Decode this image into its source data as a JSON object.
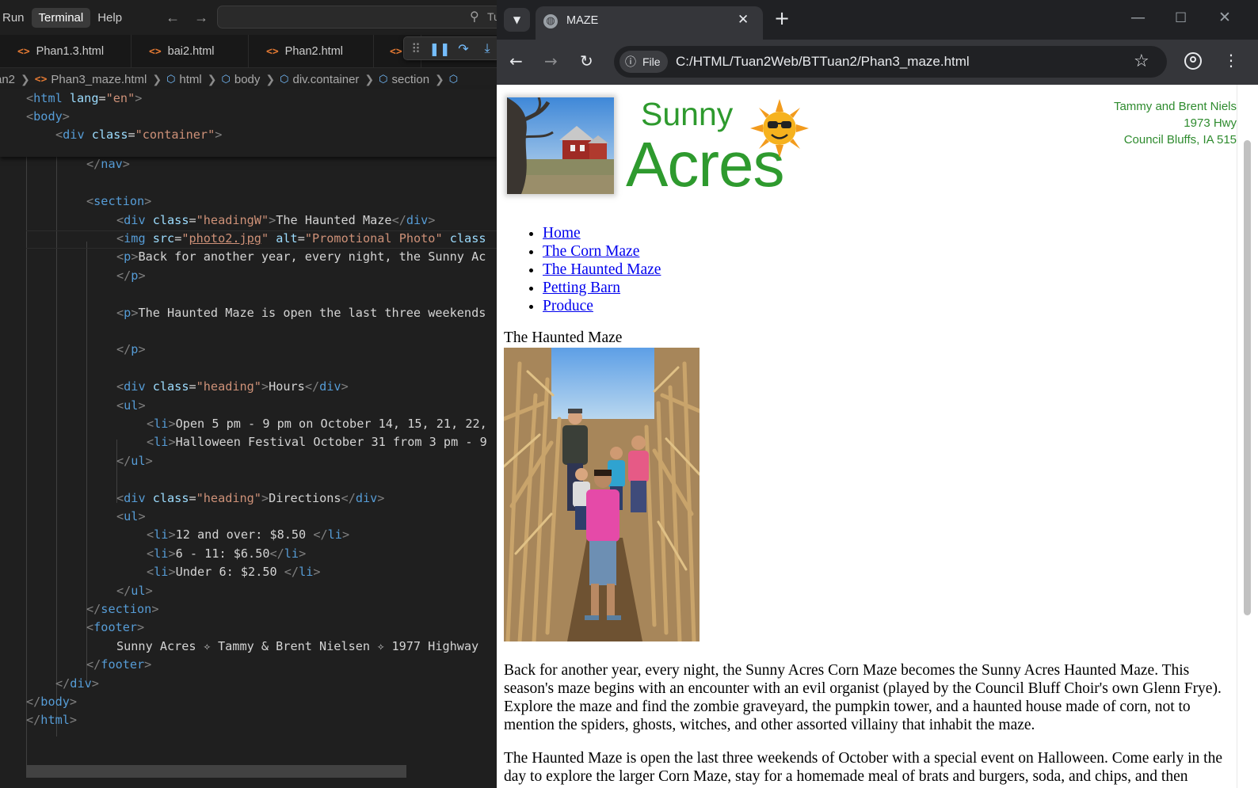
{
  "vscode": {
    "menu": {
      "run": "Run",
      "terminal": "Terminal",
      "help": "Help"
    },
    "command_center_text": "Tu",
    "tabs": [
      {
        "label": "Phan1.3.html"
      },
      {
        "label": "bai2.html"
      },
      {
        "label": "Phan2.html"
      },
      {
        "label": ""
      }
    ],
    "breadcrumb": [
      "an2",
      "Phan3_maze.html",
      "html",
      "body",
      "div.container",
      "section",
      ""
    ],
    "sticky_lines": [
      "<html lang=\"en\">",
      "<body>",
      "<div class=\"container\">"
    ],
    "code_lines": [
      "</nav>",
      "</nav>",
      "",
      "<section>",
      "<div class=\"headingW\">The Haunted Maze</div>",
      "<img src=\"photo2.jpg\" alt=\"Promotional Photo\" class",
      "<p>Back for another year, every night, the Sunny Ac",
      "</p>",
      "",
      "<p>The Haunted Maze is open the last three weekends",
      "",
      "</p>",
      "",
      "<div class=\"heading\">Hours</div>",
      "<ul>",
      "<li>Open 5 pm - 9 pm on October 14, 15, 21, 22,",
      "<li>Halloween Festival October 31 from 3 pm - 9",
      "</ul>",
      "",
      "<div class=\"heading\">Directions</div>",
      "<ul>",
      "<li>12 and over: $8.50 </li>",
      "<li>6 - 11: $6.50</li>",
      "<li>Under 6: $2.50 </li>",
      "</ul>",
      "</section>",
      "<footer>",
      "Sunny Acres ✧ Tammy & Brent Nielsen ✧ 1977 Highway",
      "</footer>",
      "</div>",
      "</body>",
      "</html>"
    ]
  },
  "browser": {
    "tab_title": "MAZE",
    "chip_label": "File",
    "url": "C:/HTML/Tuan2Web/BTTuan2/Phan3_maze.html",
    "icons": {
      "back": "arrow-left-icon",
      "forward": "arrow-right-icon",
      "reload": "reload-icon",
      "star": "star-icon",
      "profile": "profile-icon",
      "menu": "kebab-menu-icon"
    }
  },
  "page": {
    "logo_sunny": "Sunny",
    "logo_acres": "Acres",
    "address": [
      "Tammy and Brent Niels",
      "1973 Hwy",
      "Council Bluffs, IA  515"
    ],
    "nav": [
      "Home",
      "The Corn Maze",
      "The Haunted Maze",
      "Petting Barn",
      "Produce"
    ],
    "heading": "The Haunted Maze",
    "para1": "Back for another year, every night, the Sunny Acres Corn Maze becomes the Sunny Acres Haunted Maze. This season's maze begins with an encounter with an evil organist (played by the Council Bluff Choir's own Glenn Frye). Explore the maze and find the zombie graveyard, the pumpkin tower, and a haunted house made of corn, not to mention the spiders, ghosts, witches, and other assorted villainy that inhabit the maze.",
    "para2": "The Haunted Maze is open the last three weekends of October with a special event on Halloween. Come early in the day to explore the larger Corn Maze, stay for a homemade meal of brats and burgers, soda, and chips, and then"
  },
  "colors": {
    "vscode_bg": "#1f1f1f",
    "tag": "#569cd6",
    "attr": "#9cdcfe",
    "string": "#ce9178",
    "chrome_toolbar": "#35363a",
    "logo_green": "#2e9a2e",
    "link": "#0000ee"
  }
}
